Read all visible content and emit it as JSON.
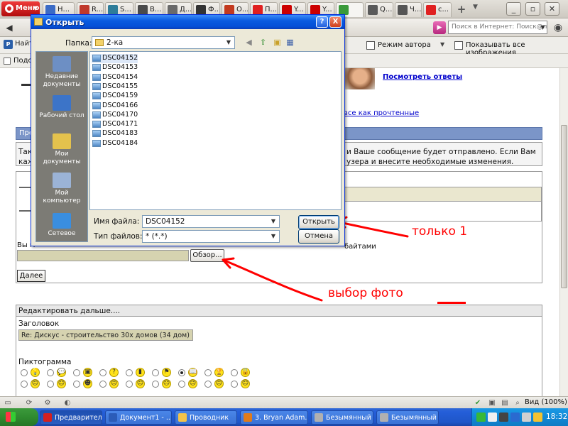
{
  "browser": {
    "menu_label": "Меню",
    "tabs": [
      {
        "label": "Н...",
        "icon": "tab-favicon",
        "color": "#3b6bc6"
      },
      {
        "label": "R...",
        "icon": "tab-favicon",
        "color": "#c0392b"
      },
      {
        "label": "S...",
        "icon": "tab-favicon",
        "color": "#2e7d9a"
      },
      {
        "label": "В...",
        "icon": "tab-favicon",
        "color": "#4a4a4a"
      },
      {
        "label": "Д...",
        "icon": "tab-favicon",
        "color": "#6a6a6a"
      },
      {
        "label": "Ф...",
        "icon": "tab-favicon",
        "color": "#333333"
      },
      {
        "label": "О...",
        "icon": "tab-favicon",
        "color": "#c33a1f"
      },
      {
        "label": "П...",
        "icon": "tab-favicon",
        "color": "#e02020"
      },
      {
        "label": "Y...",
        "icon": "youtube-icon",
        "color": "#cc0000"
      },
      {
        "label": "Y...",
        "icon": "youtube-icon",
        "color": "#cc0000"
      },
      {
        "label": "",
        "icon": "home-icon",
        "color": "#3a9a3a"
      },
      {
        "label": "Q...",
        "icon": "tab-favicon",
        "color": "#5a5a5a"
      },
      {
        "label": "Ч...",
        "icon": "tab-favicon",
        "color": "#555555"
      },
      {
        "label": "с...",
        "icon": "yandex-icon",
        "color": "#e02020"
      }
    ],
    "search_placeholder": "Поиск в Интернет: Поиск@mail...",
    "toolbar": {
      "find_label": "Найти",
      "author_mode": "Режим автора",
      "show_images": "Показывать все изображения",
      "fit_label": "Подогн"
    }
  },
  "page": {
    "see_answers": "Посмотреть ответы",
    "mark_read": "все как прочтенные",
    "preview_bar": "Пред",
    "info_left": [
      "Так",
      "каж"
    ],
    "info_right": "и Ваше сообщение будет отправлено. Если Вам узера и внесите необходимые изменения.",
    "attach_label": "Вы м",
    "bytes_label": "байтами",
    "browse_button": "Обзор...",
    "next_button": "Далее",
    "edit_more": "Редактировать дальше....",
    "heading_label": "Заголовок",
    "heading_value": "Re: Дискус - строительство 30х домов (34 дом)",
    "pictogram_label": "Пиктограмма"
  },
  "dialog": {
    "title": "Открыть",
    "lookin_label": "Папка:",
    "folder": "2-ка",
    "places": [
      "Недавние документы",
      "Рабочий стол",
      "Мои документы",
      "Мой компьютер",
      "Сетевое"
    ],
    "files": [
      "DSC04152",
      "DSC04153",
      "DSC04154",
      "DSC04155",
      "DSC04159",
      "DSC04166",
      "DSC04170",
      "DSC04171",
      "DSC04183",
      "DSC04184"
    ],
    "selected_file": "DSC04152",
    "filename_label": "Имя файла:",
    "filename_value": "DSC04152",
    "filetype_label": "Тип файлов:",
    "filetype_value": "* (*.*)",
    "open_button": "Открыть",
    "cancel_button": "Отмена",
    "help_button": "?",
    "close_button": "X"
  },
  "annotations": {
    "only_one": "только 1",
    "photo_choice": "выбор фото",
    "color": "#ff0000"
  },
  "status": {
    "zoom": "Вид (100%)"
  },
  "taskbar": {
    "tasks": [
      {
        "label": "Предварител...",
        "color": "#d42020"
      },
      {
        "label": "Документ1 - ...",
        "color": "#2b5cb8"
      },
      {
        "label": "Проводник",
        "color": "#f3c34a"
      },
      {
        "label": "3. Bryan Adam...",
        "color": "#e07b1a"
      },
      {
        "label": "Безымянный -...",
        "color": "#b0b0b0"
      },
      {
        "label": "Безымянный -...",
        "color": "#b0b0b0"
      }
    ],
    "clock": "18:32"
  }
}
